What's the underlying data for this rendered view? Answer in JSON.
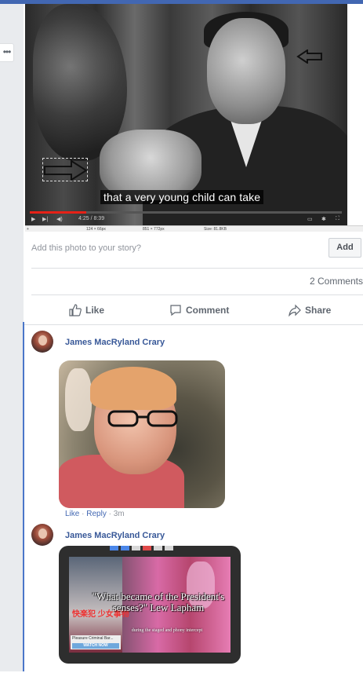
{
  "video": {
    "caption": "that a very young child can take",
    "elapsed": "4:25 / 8:39",
    "progress_fraction": 0.18,
    "status_selection": "124 × 66px",
    "status_dimensions": "851 × 772px",
    "status_size": "Size: 81.8KB"
  },
  "story": {
    "prompt": "Add this photo to your story?",
    "add_label": "Add"
  },
  "comments_count": "2 Comments",
  "actions": {
    "like": "Like",
    "comment": "Comment",
    "share": "Share"
  },
  "comments": [
    {
      "author": "James MacRyland Crary",
      "meta": {
        "like": "Like",
        "reply": "Reply",
        "time": "3m"
      }
    },
    {
      "author": "James MacRyland Crary",
      "image_text": {
        "quote": "\"What became of the President's senses?\" Lew Lapham",
        "subtitle": "during the staged and phony intercept",
        "ad_text": "Pleasure Criminal Bar...",
        "watch": "WATCH NOW",
        "cjk": "快楽犯 少女事物"
      }
    }
  ],
  "colors": {
    "accent": "#4267b2",
    "link": "#385898",
    "muted": "#90949c"
  },
  "icons": [
    "more-icon",
    "like-icon",
    "comment-icon",
    "share-icon",
    "arrow-right-icon",
    "arrow-left-icon"
  ]
}
